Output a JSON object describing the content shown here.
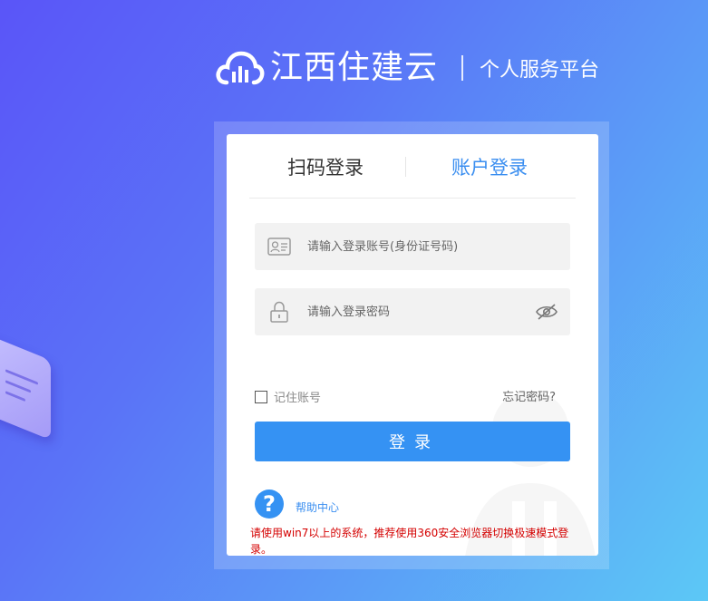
{
  "brand": {
    "name": "江西住建云",
    "subtitle": "个人服务平台"
  },
  "tabs": [
    {
      "label": "扫码登录"
    },
    {
      "label": "账户登录"
    }
  ],
  "form": {
    "username_placeholder": "请输入登录账号(身份证号码)",
    "password_placeholder": "请输入登录密码",
    "remember_label": "记住账号",
    "forgot_label": "忘记密码?",
    "login_label": "登录"
  },
  "help": {
    "icon_glyph": "?",
    "label": "帮助中心"
  },
  "notice": "请使用win7以上的系统，推荐使用360安全浏览器切换极速模式登录。",
  "colors": {
    "accent": "#3592f3",
    "notice": "#d40000"
  }
}
